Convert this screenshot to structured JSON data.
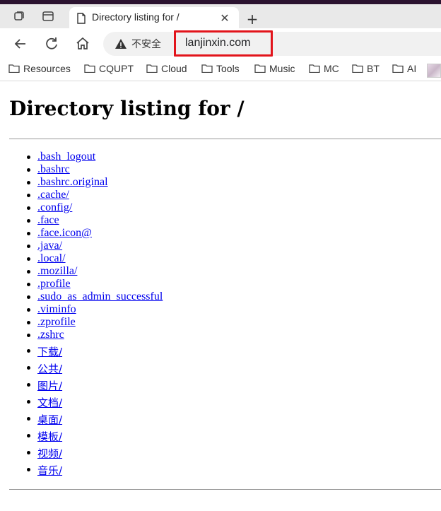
{
  "browser": {
    "tab_title": "Directory listing for /",
    "close_glyph": "✕",
    "new_tab_glyph": "+",
    "security_label": "不安全",
    "url": "lanjinxin.com"
  },
  "bookmarks": [
    "Resources",
    "CQUPT",
    "Cloud",
    "Tools",
    "Music",
    "MC",
    "BT",
    "AI"
  ],
  "page": {
    "heading": "Directory listing for /",
    "files": [
      ".bash_logout",
      ".bashrc",
      ".bashrc.original",
      ".cache/",
      ".config/",
      ".face",
      ".face.icon@",
      ".java/",
      ".local/",
      ".mozilla/",
      ".profile",
      ".sudo_as_admin_successful",
      ".viminfo",
      ".zprofile",
      ".zshrc",
      "下载/",
      "公共/",
      "图片/",
      "文档/",
      "桌面/",
      "模板/",
      "视频/",
      "音乐/"
    ]
  },
  "colors": {
    "link": "#0000ee",
    "highlight_box": "#e2141b",
    "titlebar": "#2b1330"
  }
}
